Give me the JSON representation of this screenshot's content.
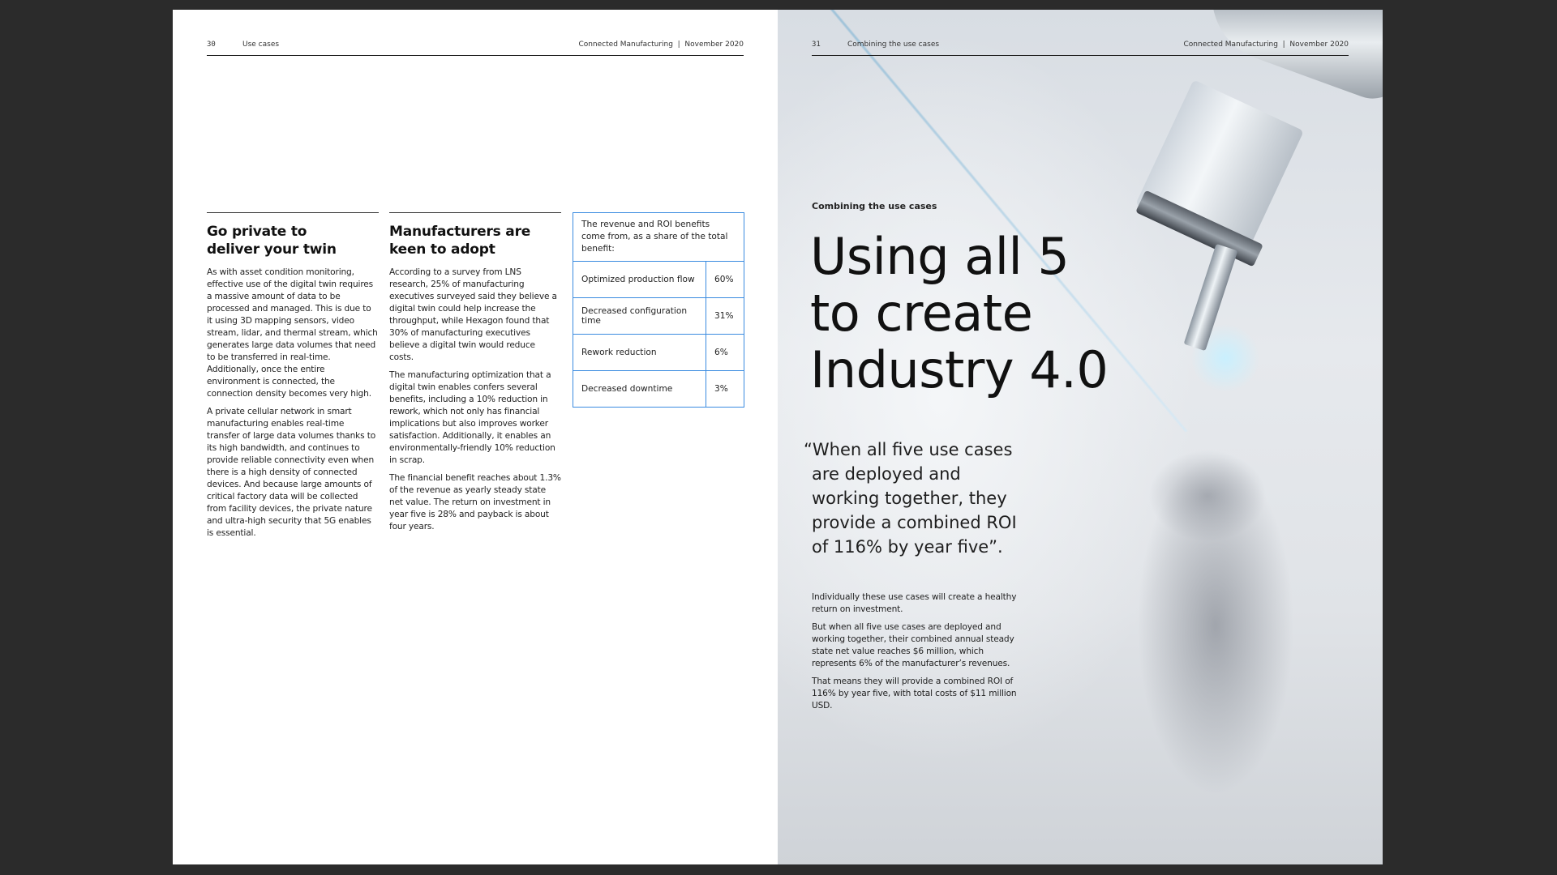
{
  "left_page": {
    "header": {
      "page_number": "30",
      "section": "Use cases",
      "publication": "Connected Manufacturing  |  November 2020"
    },
    "columns": [
      {
        "heading": "Go private to\ndeliver your twin",
        "paragraphs": [
          "As with asset condition monitoring, effective use of the digital twin requires a massive amount of data to be processed and managed. This is due to it using 3D mapping sensors, video stream, lidar, and thermal stream, which generates large data volumes that need to be transferred in real-time. Additionally, once the entire environment is connected, the connection density becomes very high.",
          "A private cellular network in smart manufacturing enables real-time transfer of large data volumes thanks to its high bandwidth, and continues to provide reliable connectivity even when there is a high density of connected devices. And because large amounts of critical factory data will be collected from facility devices, the private nature and ultra-high security that 5G enables is essential."
        ]
      },
      {
        "heading": "Manufacturers are\nkeen to adopt",
        "paragraphs": [
          "According to a survey from LNS research, 25% of manufacturing executives surveyed said they believe a digital twin could help increase the throughput, while Hexagon found that 30% of manufacturing executives believe a digital twin would reduce costs.",
          "The manufacturing optimization that a digital twin enables confers several benefits, including a 10% reduction in rework, which not only has financial implications but also improves worker satisfaction. Additionally, it enables an environmentally-friendly 10% reduction in scrap.",
          "The financial benefit reaches about 1.3% of the revenue as yearly steady state net value. The return on investment in year five is 28% and payback is about four years."
        ]
      }
    ],
    "table": {
      "caption": "The revenue and ROI benefits come from, as a share of the total benefit:",
      "rows": [
        {
          "label": "Optimized production flow",
          "value": "60%"
        },
        {
          "label": "Decreased configuration time",
          "value": "31%"
        },
        {
          "label": "Rework reduction",
          "value": "6%"
        },
        {
          "label": "Decreased downtime",
          "value": "3%"
        }
      ],
      "border_color": "#3a8be0"
    }
  },
  "right_page": {
    "header": {
      "page_number": "31",
      "section": "Combining the use cases",
      "publication": "Connected Manufacturing  |  November 2020"
    },
    "kicker": "Combining the use cases",
    "title_lines": [
      "Using all 5",
      "to create",
      "Industry 4.0"
    ],
    "quote_lines": [
      "“When all five use cases",
      "are deployed and",
      "working together, they",
      "provide a combined ROI",
      "of 116% by year five”."
    ],
    "paragraphs": [
      "Individually these use cases will create a healthy return on investment.",
      "But when all five use cases are deployed and working together, their combined annual steady state net value reaches $6 million, which represents 6% of the manufacturer’s revenues.",
      "That means they will provide a combined ROI of 116% by year five, with total costs of $11 million USD."
    ]
  }
}
